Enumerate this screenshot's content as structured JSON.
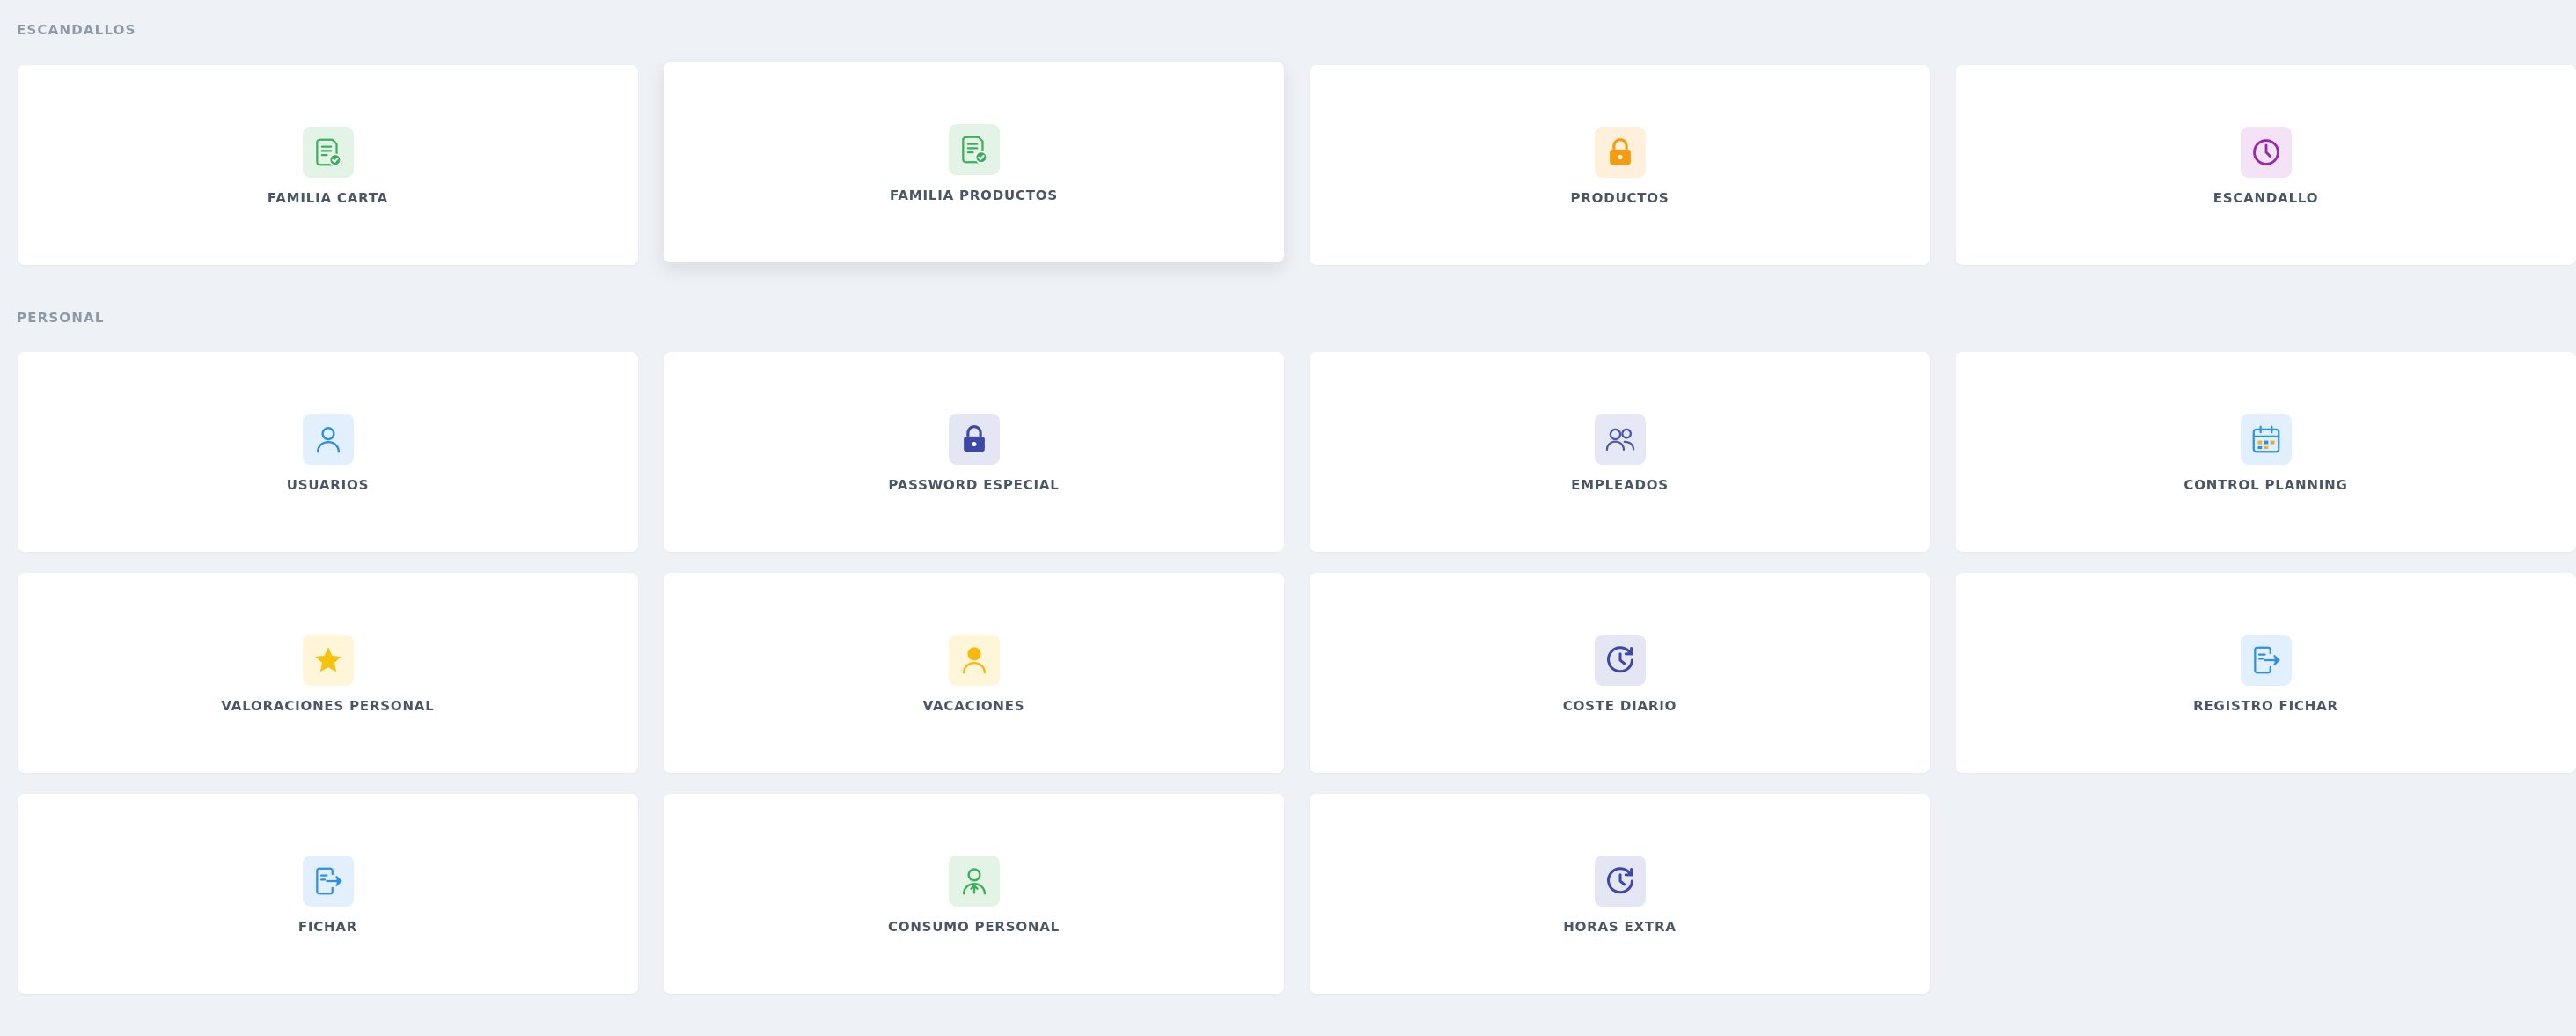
{
  "sections": {
    "escandallos": {
      "title": "ESCANDALLOS",
      "cards": [
        {
          "label": "FAMILIA CARTA",
          "icon": "document-check-icon",
          "color": "#3dae5b",
          "bg": "#e3f4e6"
        },
        {
          "label": "FAMILIA PRODUCTOS",
          "icon": "document-check-icon",
          "color": "#3dae5b",
          "bg": "#e3f4e6"
        },
        {
          "label": "PRODUCTOS",
          "icon": "lock-icon",
          "color": "#f39c12",
          "bg": "#fff0dc"
        },
        {
          "label": "ESCANDALLO",
          "icon": "clock-icon",
          "color": "#9b27af",
          "bg": "#f4e2f6"
        }
      ]
    },
    "personal": {
      "title": "PERSONAL",
      "cards": [
        {
          "label": "USUARIOS",
          "icon": "user-icon",
          "color": "#2f8fe0",
          "bg": "#e2effc"
        },
        {
          "label": "PASSWORD ESPECIAL",
          "icon": "lock-icon",
          "color": "#3d47a6",
          "bg": "#e4e6f4"
        },
        {
          "label": "EMPLEADOS",
          "icon": "users-icon",
          "color": "#4a55a8",
          "bg": "#e7e8f5"
        },
        {
          "label": "CONTROL PLANNING",
          "icon": "calendar-icon",
          "color": "#2f8fe0",
          "bg": "#e2effc"
        },
        {
          "label": "VALORACIONES PERSONAL",
          "icon": "star-icon",
          "color": "#f5c20f",
          "bg": "#fff5d8"
        },
        {
          "label": "VACACIONES",
          "icon": "person-icon",
          "color": "#f5b90f",
          "bg": "#fff5d8"
        },
        {
          "label": "COSTE DIARIO",
          "icon": "clock-history-icon",
          "color": "#3d47a6",
          "bg": "#e4e6f4"
        },
        {
          "label": "REGISTRO FICHAR",
          "icon": "sign-in-icon",
          "color": "#2f8fe0",
          "bg": "#e2effc"
        },
        {
          "label": "FICHAR",
          "icon": "sign-in-icon",
          "color": "#2f8fe0",
          "bg": "#e2effc"
        },
        {
          "label": "CONSUMO PERSONAL",
          "icon": "user-upload-icon",
          "color": "#3dae5b",
          "bg": "#e3f4e6"
        },
        {
          "label": "HORAS EXTRA",
          "icon": "clock-history-icon",
          "color": "#3d47a6",
          "bg": "#e4e6f4"
        }
      ]
    }
  }
}
